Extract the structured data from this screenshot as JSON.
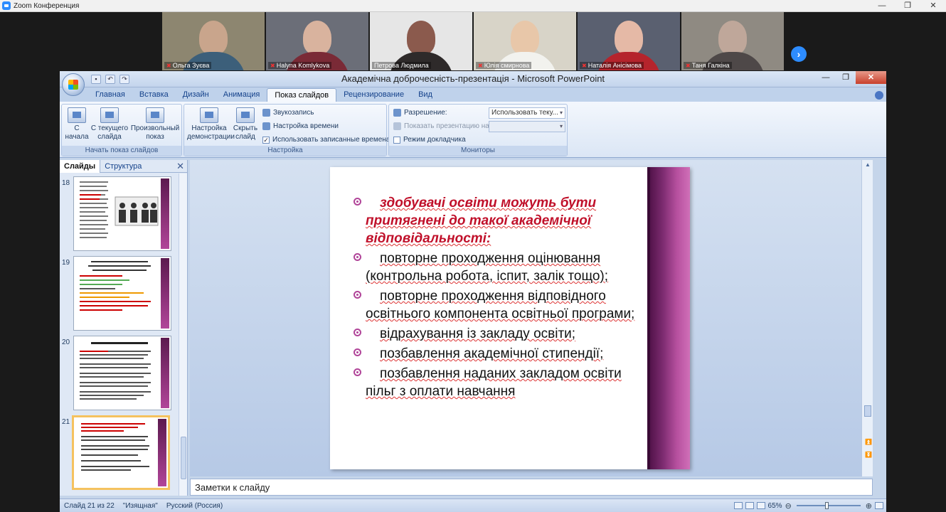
{
  "zoom": {
    "window_title": "Zoom Конференция",
    "participants": [
      {
        "name": "Ольга Зуєва",
        "bg": "#8d8670",
        "head": "#c9a58c",
        "body": "#3c5f7a"
      },
      {
        "name": "Halyna Komlykova",
        "bg": "#6b6e78",
        "head": "#d9b39e",
        "body": "#7a2a36"
      },
      {
        "name": "Петрова Людмила",
        "bg": "#e6e6e6",
        "head": "#8b5a4d",
        "body": "#2e2a2a"
      },
      {
        "name": "Юлія смирнова",
        "bg": "#d8d4c8",
        "head": "#e8c7a9",
        "body": "#f2f2ee"
      },
      {
        "name": "Наталія Анісімова",
        "bg": "#5a6070",
        "head": "#e5b9a6",
        "body": "#b5242c"
      },
      {
        "name": "Таня Галкіна",
        "bg": "#8f8a82",
        "head": "#bfa79a",
        "body": "#4e4848"
      }
    ]
  },
  "ppt": {
    "title": "Академічна доброчесність-презентація - Microsoft PowerPoint",
    "tabs": [
      "Главная",
      "Вставка",
      "Дизайн",
      "Анимация",
      "Показ слайдов",
      "Рецензирование",
      "Вид"
    ],
    "active_tab": "Показ слайдов",
    "ribbon": {
      "group1": {
        "label": "Начать показ слайдов",
        "btn_from_start": "С начала",
        "btn_from_current": "С текущего слайда",
        "btn_custom": "Произвольный показ"
      },
      "group2": {
        "label": "Настройка",
        "btn_setup": "Настройка демонстрации",
        "btn_hide": "Скрыть слайд",
        "opt_record": "Звукозапись",
        "opt_timing": "Настройка времени",
        "opt_use_timings": "Использовать записанные времена"
      },
      "group3": {
        "label": "Мониторы",
        "resolution_label": "Разрешение:",
        "resolution_value": "Использовать теку...",
        "show_on_label": "Показать презентацию на:",
        "presenter_view": "Режим докладчика"
      }
    },
    "panel": {
      "tab_slides": "Слайды",
      "tab_outline": "Структура",
      "thumbnails": [
        {
          "num": "18"
        },
        {
          "num": "19"
        },
        {
          "num": "20"
        },
        {
          "num": "21"
        }
      ]
    },
    "slide": {
      "lead_text": "здобувачі освіти можуть бути притягнені до такої академічної відповідальності:",
      "items": [
        "повторне проходження оцінювання (контрольна робота, іспит, залік тощо);",
        "повторне проходження відповідного освітнього компонента освітньої програми;",
        "відрахування із закладу освіти;",
        "позбавлення академічної стипендії;",
        "позбавлення наданих закладом освіти пільг з оплати навчання"
      ]
    },
    "notes_placeholder": "Заметки к слайду",
    "status": {
      "slide_info": "Слайд 21 из 22",
      "theme": "\"Изящная\"",
      "language": "Русский (Россия)",
      "zoom": "65%"
    }
  }
}
